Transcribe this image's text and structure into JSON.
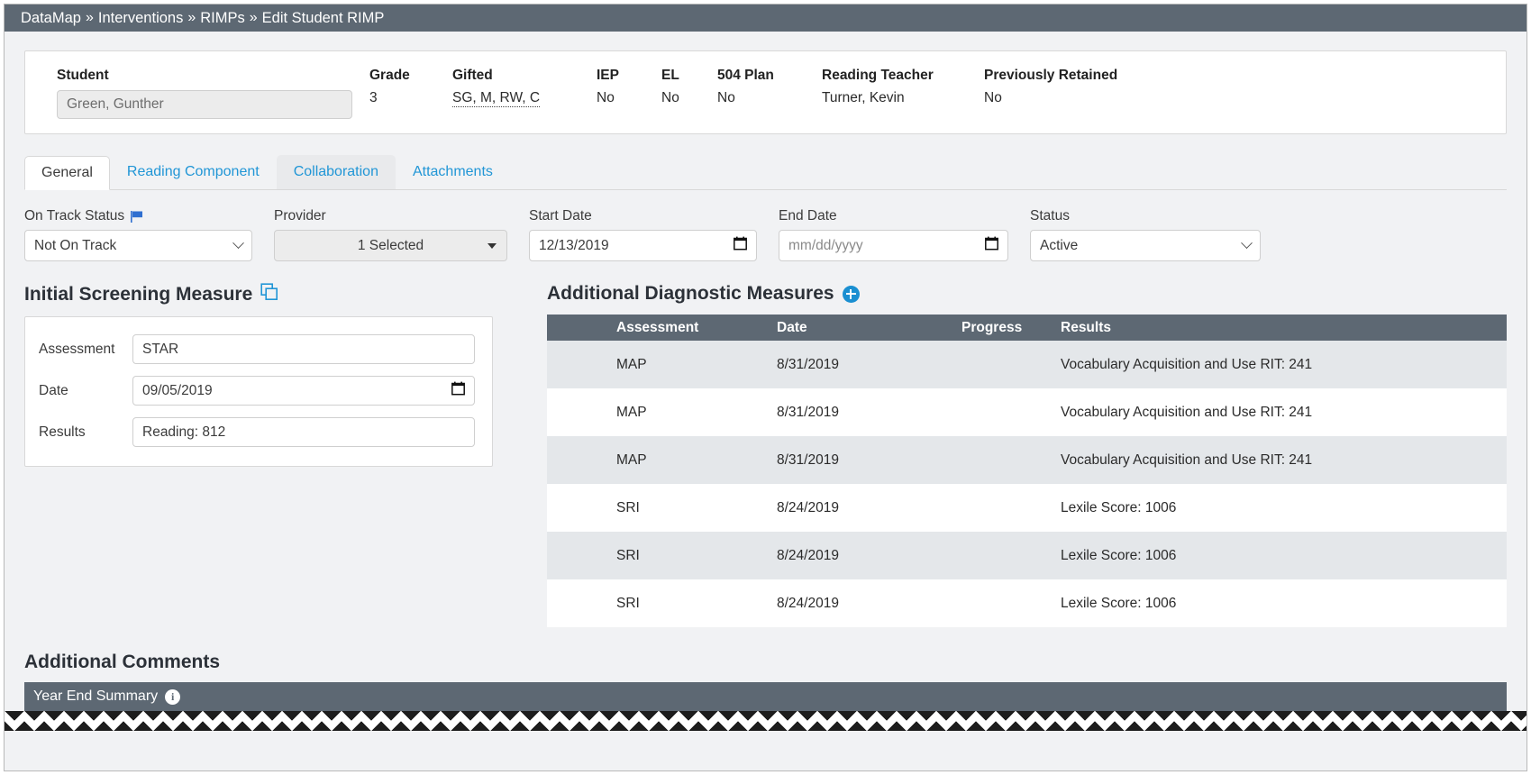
{
  "breadcrumb": {
    "items": [
      "DataMap",
      "Interventions",
      "RIMPs",
      "Edit Student RIMP"
    ],
    "separator": "»"
  },
  "student_header": {
    "student_label": "Student",
    "student_value": "Green, Gunther",
    "fields": [
      {
        "label": "Grade",
        "value": "3",
        "dotted": false
      },
      {
        "label": "Gifted",
        "value": "SG, M, RW, C",
        "dotted": true
      },
      {
        "label": "IEP",
        "value": "No",
        "dotted": false
      },
      {
        "label": "EL",
        "value": "No",
        "dotted": false
      },
      {
        "label": "504 Plan",
        "value": "No",
        "dotted": false
      },
      {
        "label": "Reading Teacher",
        "value": "Turner, Kevin",
        "dotted": false
      },
      {
        "label": "Previously Retained",
        "value": "No",
        "dotted": false
      }
    ]
  },
  "tabs": [
    {
      "label": "General",
      "state": "active"
    },
    {
      "label": "Reading Component",
      "state": "normal"
    },
    {
      "label": "Collaboration",
      "state": "hover"
    },
    {
      "label": "Attachments",
      "state": "normal"
    }
  ],
  "form": {
    "on_track_status": {
      "label": "On Track Status",
      "value": "Not On Track",
      "icon": "flag-icon"
    },
    "provider": {
      "label": "Provider",
      "value": "1 Selected"
    },
    "start_date": {
      "label": "Start Date",
      "value": "12/13/2019",
      "placeholder": "mm/dd/yyyy"
    },
    "end_date": {
      "label": "End Date",
      "value": "",
      "placeholder": "mm/dd/yyyy"
    },
    "status": {
      "label": "Status",
      "value": "Active"
    }
  },
  "initial_screening": {
    "heading": "Initial Screening Measure",
    "copy_icon": "copy-icon",
    "rows": [
      {
        "label": "Assessment",
        "value": "STAR",
        "type": "text"
      },
      {
        "label": "Date",
        "value": "09/05/2019",
        "type": "date"
      },
      {
        "label": "Results",
        "value": "Reading: 812",
        "type": "text"
      }
    ]
  },
  "diagnostic_measures": {
    "heading": "Additional Diagnostic Measures",
    "add_icon": "plus-circle-icon",
    "columns": [
      "Assessment",
      "Date",
      "Progress",
      "Results"
    ],
    "rows": [
      {
        "assessment": "MAP",
        "date": "8/31/2019",
        "progress": "",
        "results": "Vocabulary Acquisition and Use RIT: 241"
      },
      {
        "assessment": "MAP",
        "date": "8/31/2019",
        "progress": "",
        "results": "Vocabulary Acquisition and Use RIT: 241"
      },
      {
        "assessment": "MAP",
        "date": "8/31/2019",
        "progress": "",
        "results": "Vocabulary Acquisition and Use RIT: 241"
      },
      {
        "assessment": "SRI",
        "date": "8/24/2019",
        "progress": "",
        "results": "Lexile Score: 1006"
      },
      {
        "assessment": "SRI",
        "date": "8/24/2019",
        "progress": "",
        "results": "Lexile Score: 1006"
      },
      {
        "assessment": "SRI",
        "date": "8/24/2019",
        "progress": "",
        "results": "Lexile Score: 1006"
      }
    ]
  },
  "comments": {
    "heading": "Additional Comments",
    "year_end_summary": {
      "label": "Year End Summary",
      "icon": "info-icon"
    }
  },
  "colors": {
    "header_bar": "#5d6873",
    "link_blue": "#2196d6",
    "accent_blue": "#1a8fd1",
    "page_bg": "#f1f2f4",
    "row_stripe": "#e4e7ea"
  }
}
